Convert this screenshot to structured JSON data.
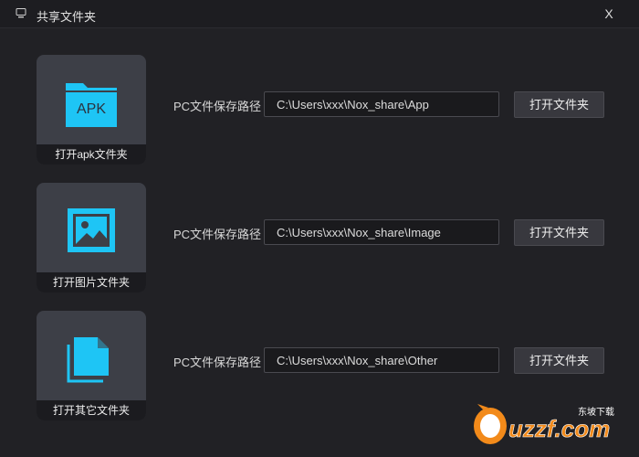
{
  "window": {
    "title": "共享文件夹",
    "close_glyph": "X"
  },
  "accent_color": "#1ec5f5",
  "rows": [
    {
      "tile_icon": "apk-folder-icon",
      "tile_icon_text": "APK",
      "tile_caption": "打开apk文件夹",
      "path_label": "PC文件保存路径",
      "path_value": "C:\\Users\\xxx\\Nox_share\\App",
      "button_label": "打开文件夹"
    },
    {
      "tile_icon": "image-icon",
      "tile_caption": "打开图片文件夹",
      "path_label": "PC文件保存路径",
      "path_value": "C:\\Users\\xxx\\Nox_share\\Image",
      "button_label": "打开文件夹"
    },
    {
      "tile_icon": "documents-icon",
      "tile_caption": "打开其它文件夹",
      "path_label": "PC文件保存路径",
      "path_value": "C:\\Users\\xxx\\Nox_share\\Other",
      "button_label": "打开文件夹"
    }
  ],
  "watermark": {
    "text_main": "uzzf.com",
    "text_sub": "东坡下载"
  }
}
